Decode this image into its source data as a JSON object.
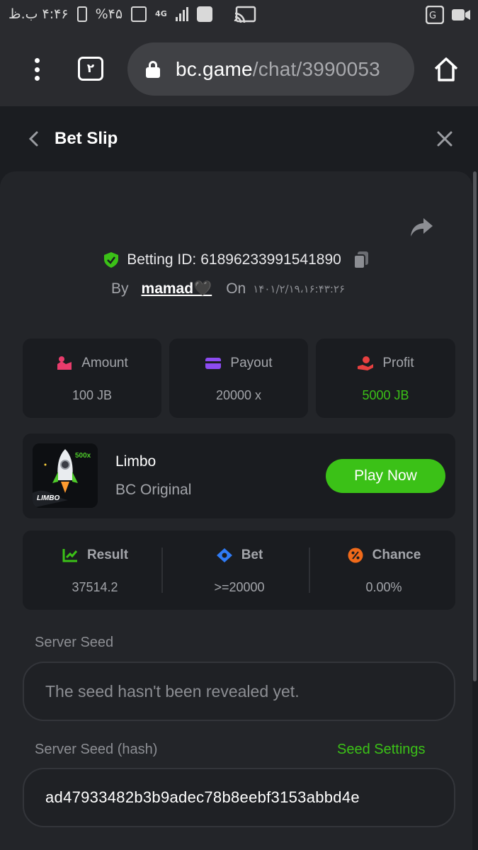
{
  "status_bar": {
    "time": "۴:۴۶ ب.ظ",
    "battery": "%۴۵",
    "network": "4G"
  },
  "browser": {
    "tab_count": "۲",
    "url_host": "bc.game",
    "url_path": "/chat/3990053"
  },
  "page": {
    "title": "Bet Slip"
  },
  "bet": {
    "betting_id_label": "Betting ID:",
    "betting_id": "61896233991541890",
    "by_label": "By",
    "username": "mamad🖤",
    "on_label": "On",
    "date": "۱۴۰۱/۲/۱۹،۱۶:۴۳:۲۶"
  },
  "stats": [
    {
      "label": "Amount",
      "value": "100 JB",
      "icon": "amount-icon"
    },
    {
      "label": "Payout",
      "value": "20000 x",
      "icon": "wallet-icon"
    },
    {
      "label": "Profit",
      "value": "5000 JB",
      "icon": "profit-icon"
    }
  ],
  "game": {
    "name": "Limbo",
    "provider": "BC Original",
    "thumb_label": "LIMBO",
    "thumb_multiplier": "500x",
    "play_label": "Play Now"
  },
  "result": [
    {
      "label": "Result",
      "value": "37514.2",
      "icon": "result-chart-icon"
    },
    {
      "label": "Bet",
      "value": ">=20000",
      "icon": "bet-target-icon"
    },
    {
      "label": "Chance",
      "value": "0.00%",
      "icon": "percent-icon"
    }
  ],
  "seeds": {
    "server_seed_label": "Server Seed",
    "server_seed_placeholder": "The seed hasn't been revealed yet.",
    "server_hash_label": "Server Seed (hash)",
    "seed_settings_label": "Seed Settings",
    "server_hash_value": "ad47933482b3b9adec78b8eebf3153abbd4e"
  },
  "colors": {
    "accent_green": "#3bc117",
    "background": "#1b1d21",
    "panel": "#232529",
    "card": "#1a1c20"
  }
}
